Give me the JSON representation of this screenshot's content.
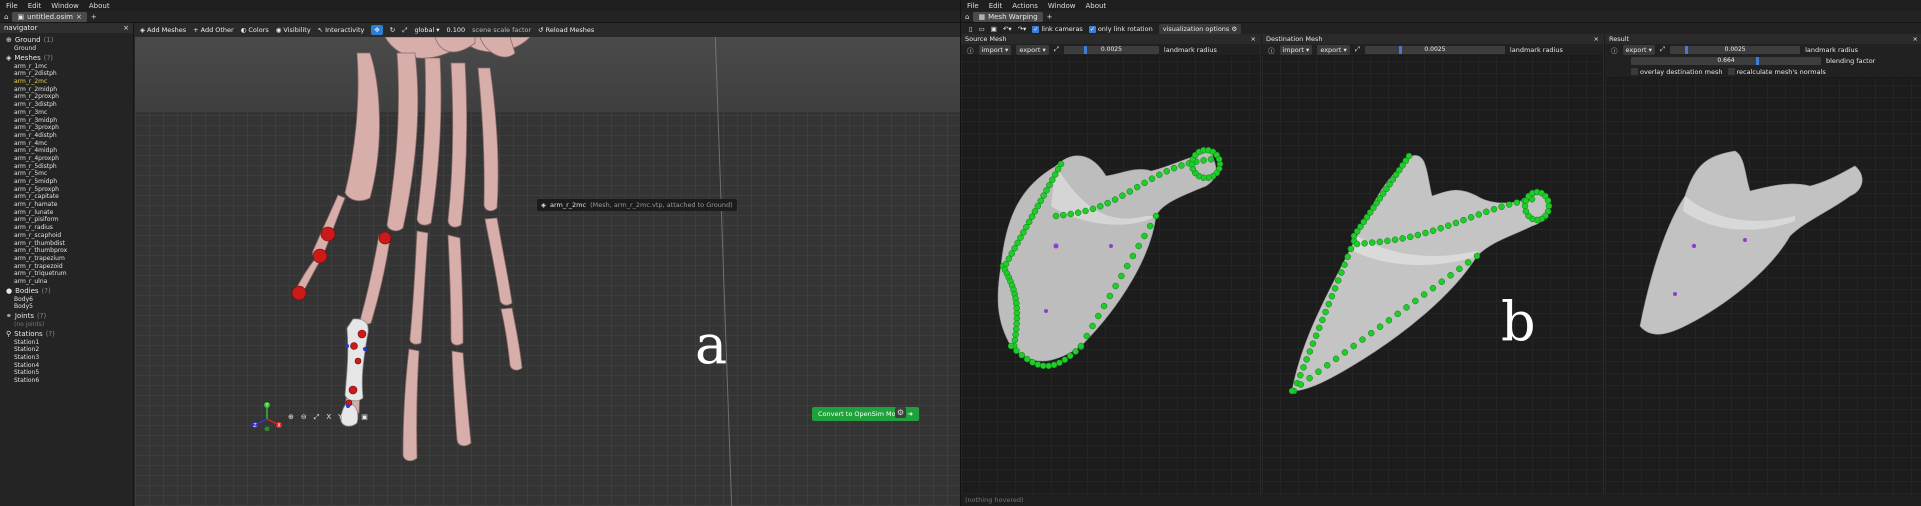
{
  "left": {
    "menu": [
      "File",
      "Edit",
      "Window",
      "About"
    ],
    "tabs": {
      "file": "untitled.osim",
      "viewer": "wizard_3dviewer"
    },
    "nav": {
      "title": "navigator",
      "ground": {
        "label": "Ground",
        "count": "(1)",
        "items": [
          "Ground"
        ]
      },
      "meshes": {
        "label": "Meshes",
        "count": "(?)",
        "items": [
          "arm_r_1mc",
          "arm_r_2distph",
          "arm_r_2mc",
          "arm_r_2midph",
          "arm_r_2proxph",
          "arm_r_3distph",
          "arm_r_3mc",
          "arm_r_3midph",
          "arm_r_3proxph",
          "arm_r_4distph",
          "arm_r_4mc",
          "arm_r_4midph",
          "arm_r_4proxph",
          "arm_r_5distph",
          "arm_r_5mc",
          "arm_r_5midph",
          "arm_r_5proxph",
          "arm_r_capitate",
          "arm_r_hamate",
          "arm_r_lunate",
          "arm_r_pisiform",
          "arm_r_radius",
          "arm_r_scaphoid",
          "arm_r_thumbdist",
          "arm_r_thumbprox",
          "arm_r_trapezium",
          "arm_r_trapezoid",
          "arm_r_triquetrum",
          "arm_r_ulna"
        ]
      },
      "bodies": {
        "label": "Bodies",
        "count": "(?)",
        "items": [
          "Body6",
          "Body5"
        ]
      },
      "joints": {
        "label": "Joints",
        "count": "(?)",
        "items": [
          "(no joints)"
        ]
      },
      "stations": {
        "label": "Stations",
        "count": "(?)",
        "items": [
          "Station1",
          "Station2",
          "Station3",
          "Station4",
          "Station5",
          "Station6"
        ]
      }
    },
    "toolbar": {
      "add_meshes": "Add Meshes",
      "add_other": "Add Other",
      "colors": "Colors",
      "visibility": "Visibility",
      "interactivity": "Interactivity",
      "global": "global",
      "scale": "0.100",
      "scale_label": "scene scale factor",
      "reload": "Reload Meshes"
    },
    "tooltip": {
      "name": "arm_r_2mc",
      "detail": "(Mesh, arm_r_2mc.vtp, attached to Ground)"
    },
    "convert": "Convert to OpenSim Model",
    "axis_labels": {
      "x": "X",
      "y": "Y",
      "z": "Z"
    },
    "view_labels": [
      "X",
      "Y",
      "Z"
    ],
    "label": "a"
  },
  "right": {
    "menu": [
      "File",
      "Edit",
      "Actions",
      "Window",
      "About"
    ],
    "tab": "Mesh Warping",
    "controls": {
      "link_cameras": "link cameras",
      "link_rotation": "only link rotation",
      "vis_options": "visualization options"
    },
    "source": {
      "title": "Source Mesh",
      "import": "import",
      "export": "export",
      "radius": "0.0025",
      "radius_label": "landmark radius"
    },
    "dest": {
      "title": "Destination Mesh",
      "import": "import",
      "export": "export",
      "radius": "0.0025",
      "radius_label": "landmark radius"
    },
    "result": {
      "title": "Result",
      "export": "export",
      "radius": "0.0025",
      "radius_label": "landmark radius",
      "blend": "0.664",
      "blend_label": "blending factor",
      "overlay": "overlay destination mesh",
      "recalc": "recalculate mesh's normals"
    },
    "status": "(nothing hovered)",
    "label": "b"
  },
  "colors": {
    "bone": "#d8aeaa",
    "landmark": "#1fcc2a",
    "marker": "#cc1a1a",
    "accent": "#3d7fd6",
    "convert": "#1fa13b"
  }
}
